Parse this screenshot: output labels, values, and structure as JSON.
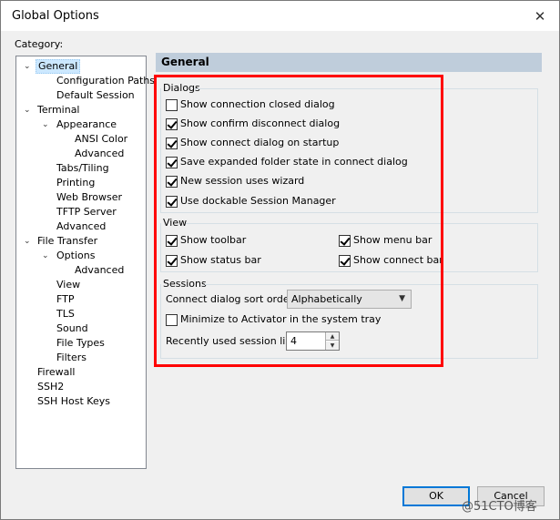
{
  "window": {
    "title": "Global Options",
    "close_glyph": "✕"
  },
  "category": {
    "label": "Category:",
    "tree": [
      {
        "label": "General",
        "selected": true,
        "expanded": true
      },
      {
        "label": "Configuration Paths"
      },
      {
        "label": "Default Session"
      },
      {
        "label": "Terminal",
        "expanded": true
      },
      {
        "label": "Appearance",
        "expanded": true
      },
      {
        "label": "ANSI Color"
      },
      {
        "label": "Advanced"
      },
      {
        "label": "Tabs/Tiling"
      },
      {
        "label": "Printing"
      },
      {
        "label": "Web Browser"
      },
      {
        "label": "TFTP Server"
      },
      {
        "label": "Advanced"
      },
      {
        "label": "File Transfer",
        "expanded": true
      },
      {
        "label": "Options",
        "expanded": true
      },
      {
        "label": "Advanced"
      },
      {
        "label": "View"
      },
      {
        "label": "FTP"
      },
      {
        "label": "TLS"
      },
      {
        "label": "Sound"
      },
      {
        "label": "File Types"
      },
      {
        "label": "Filters"
      },
      {
        "label": "Firewall"
      },
      {
        "label": "SSH2"
      },
      {
        "label": "SSH Host Keys"
      }
    ]
  },
  "panel": {
    "header": "General",
    "dialogs": {
      "title": "Dialogs",
      "options": [
        {
          "label": "Show connection closed dialog",
          "checked": false
        },
        {
          "label": "Show confirm disconnect dialog",
          "checked": true
        },
        {
          "label": "Show connect dialog on startup",
          "checked": true
        },
        {
          "label": "Save expanded folder state in connect dialog",
          "checked": true
        },
        {
          "label": "New session uses wizard",
          "checked": true
        },
        {
          "label": "Use dockable Session Manager",
          "checked": true
        }
      ]
    },
    "view": {
      "title": "View",
      "options": [
        {
          "label": "Show toolbar",
          "checked": true
        },
        {
          "label": "Show menu bar",
          "checked": true
        },
        {
          "label": "Show status bar",
          "checked": true
        },
        {
          "label": "Show connect bar",
          "checked": true
        }
      ]
    },
    "sessions": {
      "title": "Sessions",
      "sort_label": "Connect dialog sort order:",
      "sort_value": "Alphabetically",
      "minimize_label": "Minimize to Activator in the system tray",
      "minimize_checked": false,
      "recent_label": "Recently used session list:",
      "recent_value": "4"
    }
  },
  "buttons": {
    "ok": "OK",
    "cancel": "Cancel"
  },
  "watermark": "@51CTO博客",
  "colors": {
    "highlight": "#ff0000",
    "header_bg": "#bfcddb",
    "ok_border": "#0078d7"
  }
}
